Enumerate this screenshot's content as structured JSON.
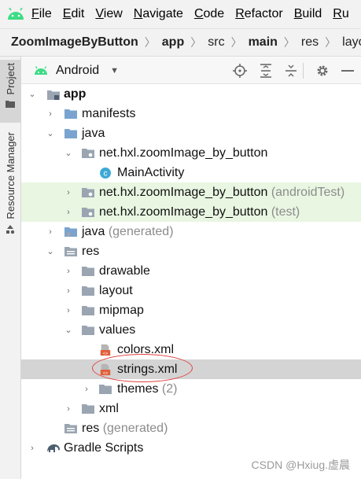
{
  "menu": {
    "items": [
      {
        "pre": "",
        "u": "F",
        "post": "ile"
      },
      {
        "pre": "",
        "u": "E",
        "post": "dit"
      },
      {
        "pre": "",
        "u": "V",
        "post": "iew"
      },
      {
        "pre": "",
        "u": "N",
        "post": "avigate"
      },
      {
        "pre": "",
        "u": "C",
        "post": "ode"
      },
      {
        "pre": "",
        "u": "R",
        "post": "efactor"
      },
      {
        "pre": "",
        "u": "B",
        "post": "uild"
      },
      {
        "pre": "",
        "u": "R",
        "post": "u"
      }
    ]
  },
  "breadcrumb": [
    "ZoomImageByButton",
    "app",
    "src",
    "main",
    "res",
    "layout"
  ],
  "side_tabs": {
    "project": "Project",
    "resource_manager": "Resource Manager"
  },
  "toolbar": {
    "view": "Android"
  },
  "tree": [
    {
      "label": "app",
      "bold": true
    },
    {
      "label": "manifests"
    },
    {
      "label": "java"
    },
    {
      "label": "net.hxl.zoomImage_by_button"
    },
    {
      "label": "MainActivity"
    },
    {
      "label": "net.hxl.zoomImage_by_button",
      "suffix": "(androidTest)"
    },
    {
      "label": "net.hxl.zoomImage_by_button",
      "suffix": "(test)"
    },
    {
      "label": "java",
      "suffix": "(generated)"
    },
    {
      "label": "res"
    },
    {
      "label": "drawable"
    },
    {
      "label": "layout"
    },
    {
      "label": "mipmap"
    },
    {
      "label": "values"
    },
    {
      "label": "colors.xml"
    },
    {
      "label": "strings.xml"
    },
    {
      "label": "themes",
      "suffix": "(2)"
    },
    {
      "label": "xml"
    },
    {
      "label": "res",
      "suffix": "(generated)"
    },
    {
      "label": "Gradle Scripts"
    }
  ],
  "watermark": "CSDN @Hxiug.虚晨",
  "colors": {
    "green_row": "#e9f6e2",
    "selected_row": "#d4d4d4",
    "folder": "#7aa4cf",
    "android": "#3ddc84",
    "xml": "#e0603c",
    "annotation": "#e0403f"
  }
}
